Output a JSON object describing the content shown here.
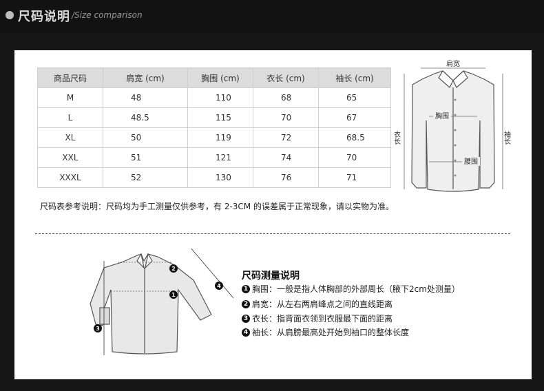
{
  "header": {
    "title": "尺码说明",
    "subtitle": "/Size comparison"
  },
  "table": {
    "headers": [
      "商品尺码",
      "肩宽 (cm)",
      "胸围 (cm)",
      "衣长 (cm)",
      "袖长 (cm)"
    ],
    "rows": [
      [
        "M",
        "48",
        "110",
        "68",
        "65"
      ],
      [
        "L",
        "48.5",
        "115",
        "70",
        "67"
      ],
      [
        "XL",
        "50",
        "119",
        "72",
        "68.5"
      ],
      [
        "XXL",
        "51",
        "121",
        "74",
        "70"
      ],
      [
        "XXXL",
        "52",
        "130",
        "76",
        "71"
      ]
    ]
  },
  "note": "尺码表参考说明：尺码均为手工测量仅供参考，有 2-3CM 的误差属于正常现象，请以实物为准。",
  "diagram1": {
    "shoulder": "肩宽",
    "chest": "胸围",
    "waist": "腰围",
    "length": "衣长",
    "sleeve": "袖长"
  },
  "diagram2": {
    "n1": "1",
    "n2": "2",
    "n3": "3",
    "n4": "4"
  },
  "measure": {
    "title": "尺码测量说明",
    "items": [
      {
        "num": "1",
        "text": "胸围：一般是指人体胸部的外部周长（腋下2cm处测量）"
      },
      {
        "num": "2",
        "text": "肩宽：从左右两肩峰点之间的直线距离"
      },
      {
        "num": "3",
        "text": "衣长：指背面衣领到衣服最下面的距离"
      },
      {
        "num": "4",
        "text": "袖长：从肩膀最高处开始到袖口的整体长度"
      }
    ]
  }
}
